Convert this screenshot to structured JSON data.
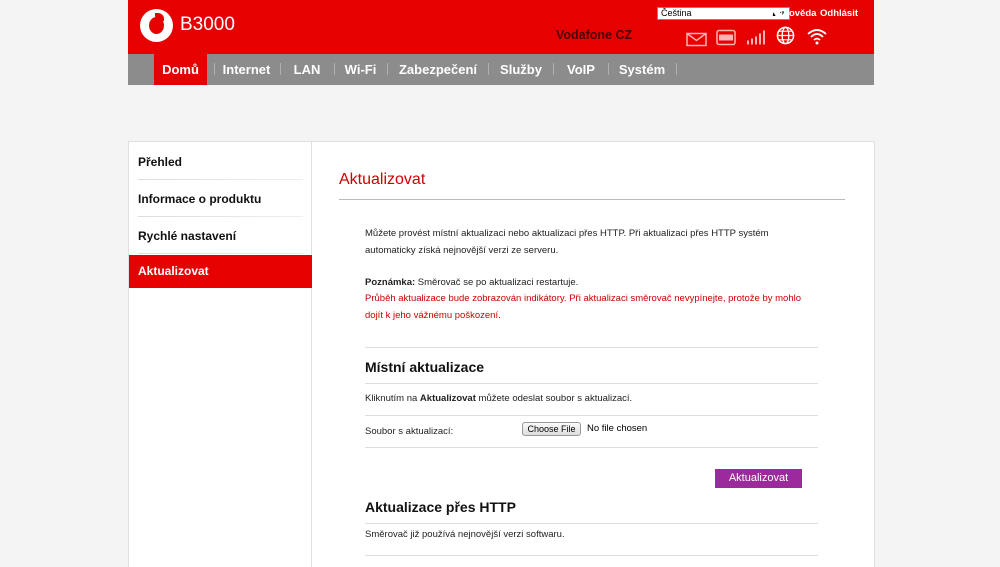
{
  "header": {
    "model": "B3000",
    "language": "Čeština",
    "help": "Nápověda",
    "logout": "Odhlásit",
    "provider": "Vodafone CZ"
  },
  "nav": [
    "Domů",
    "Internet",
    "LAN",
    "Wi-Fi",
    "Zabezpečení",
    "Služby",
    "VoIP",
    "Systém"
  ],
  "sidebar": [
    "Přehled",
    "Informace o produktu",
    "Rychlé nastavení",
    "Aktualizovat"
  ],
  "content": {
    "title": "Aktualizovat",
    "intro_line1": "Můžete provést místní aktualizaci nebo aktualizaci přes HTTP. Při aktualizaci přes HTTP systém",
    "intro_line2": "automaticky získá nejnovější verzi ze serveru.",
    "note_label": "Poznámka:",
    "note_text": " Směrovač se po aktualizaci restartuje.",
    "warning_line1": "Průběh aktualizace bude zobrazován indikátory. Při aktualizaci směrovač nevypínejte, protože by mohlo",
    "warning_line2": "dojít k jeho vážnému poškození.",
    "local_title": "Místní aktualizace",
    "local_desc_pre": "Kliknutím na ",
    "local_desc_bold": "Aktualizovat",
    "local_desc_post": " můžete odeslat soubor s aktualizací.",
    "file_label": "Soubor s aktualizací:",
    "choose_file": "Choose File",
    "no_file": "No file chosen",
    "update_button": "Aktualizovat",
    "http_title": "Aktualizace přes HTTP",
    "http_desc": "Směrovač již používá nejnovější verzi softwaru."
  }
}
